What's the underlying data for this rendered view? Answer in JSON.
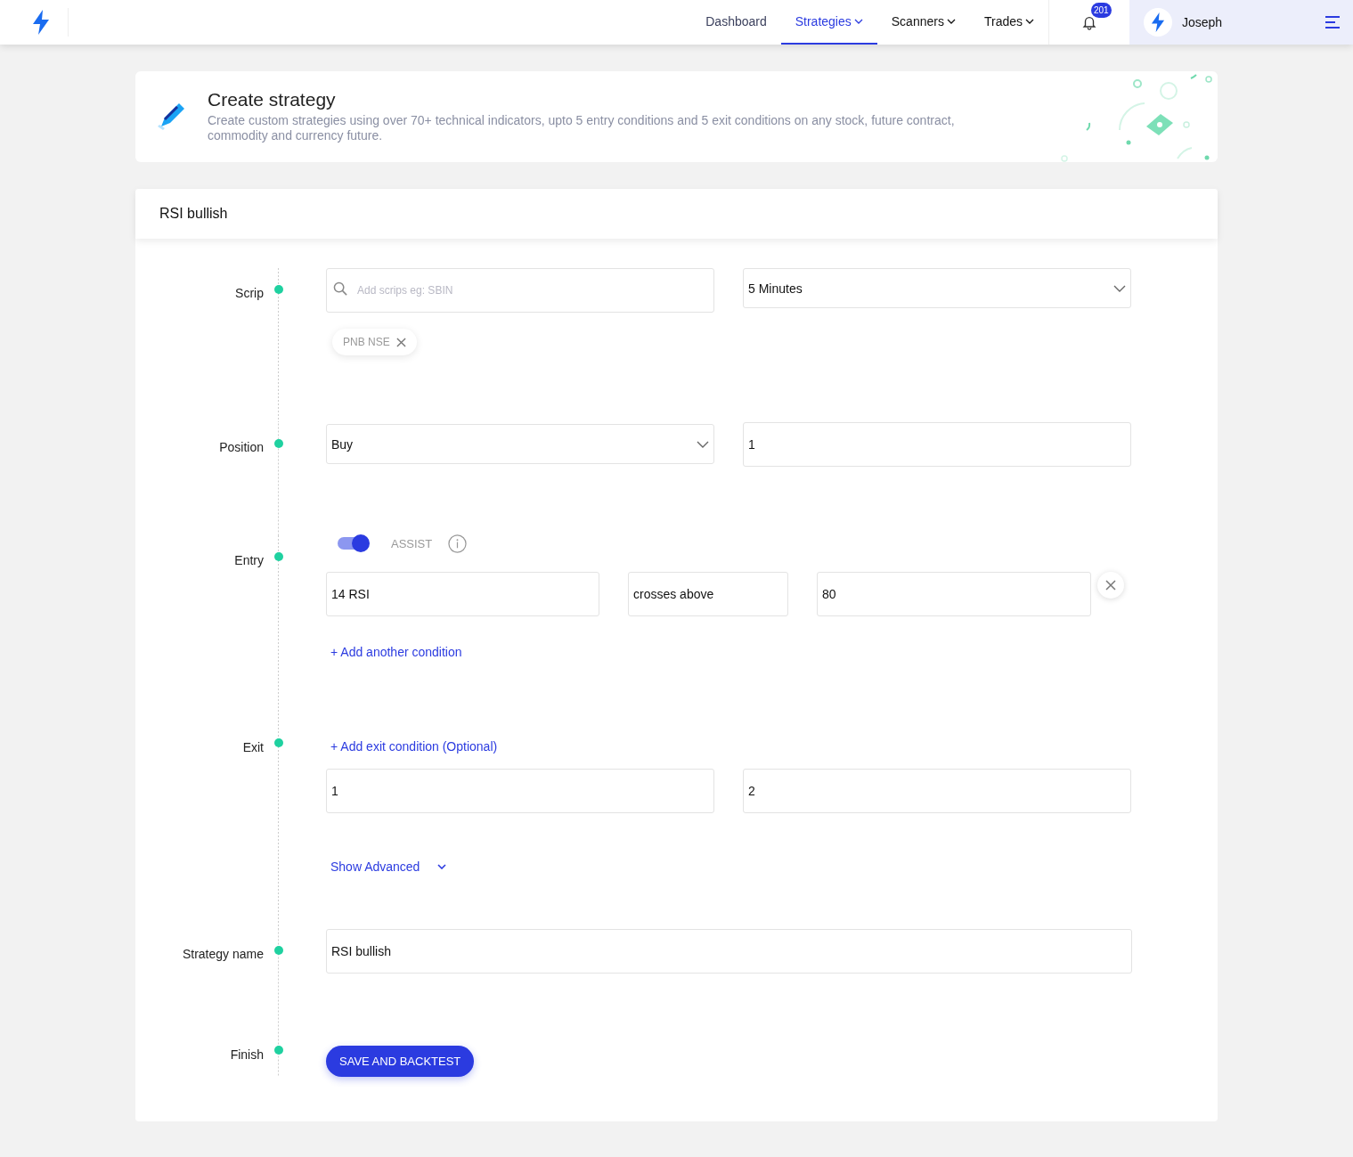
{
  "nav": {
    "items": [
      {
        "label": "Dashboard",
        "selected": false,
        "dropdown": false
      },
      {
        "label": "Strategies",
        "selected": true,
        "dropdown": true
      },
      {
        "label": "Scanners",
        "selected": false,
        "dropdown": true
      },
      {
        "label": "Trades",
        "selected": false,
        "dropdown": true
      }
    ],
    "notifications": "201",
    "user": "Joseph"
  },
  "hero": {
    "title": "Create strategy",
    "description": "Create custom strategies using over 70+ technical indicators, upto 5 entry conditions and 5 exit conditions on any stock, future contract, commodity and currency future."
  },
  "form": {
    "title": "RSI bullish",
    "scrip": {
      "label": "Scrip",
      "placeholder": "Add scrips eg: SBIN",
      "chips": [
        "PNB NSE"
      ],
      "interval": "5 Minutes"
    },
    "position": {
      "label": "Position",
      "side": "Buy",
      "quantity": "1"
    },
    "entry": {
      "label": "Entry",
      "assist_label": "ASSIST",
      "assist_on": true,
      "condition": [
        "14 RSI",
        "crosses above",
        "80"
      ],
      "add_link": "+ Add another condition"
    },
    "exit": {
      "label": "Exit",
      "add_link": "+ Add exit condition (Optional)",
      "values": [
        "1",
        "2"
      ],
      "advanced_link": "Show Advanced"
    },
    "name": {
      "label": "Strategy name",
      "value": "RSI bullish"
    },
    "finish": {
      "label": "Finish",
      "button": "SAVE AND BACKTEST"
    }
  }
}
